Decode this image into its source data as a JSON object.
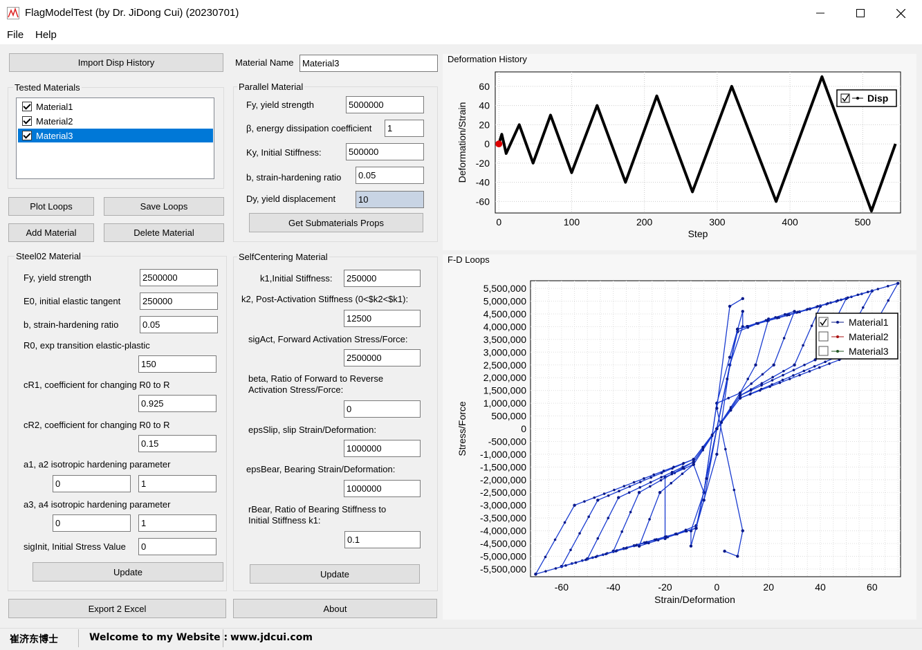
{
  "window": {
    "title": "FlagModelTest  (by Dr. JiDong Cui) (20230701)"
  },
  "menu": [
    "File",
    "Help"
  ],
  "left": {
    "import_label": "Import Disp History",
    "tested_title": "Tested Materials",
    "materials": [
      {
        "name": "Material1",
        "checked": true,
        "selected": false
      },
      {
        "name": "Material2",
        "checked": true,
        "selected": false
      },
      {
        "name": "Material3",
        "checked": true,
        "selected": true
      }
    ],
    "plot_loops": "Plot Loops",
    "save_loops": "Save Loops",
    "add_material": "Add Material",
    "delete_material": "Delete Material",
    "export_excel": "Export 2 Excel"
  },
  "material_name": {
    "label": "Material Name",
    "value": "Material3"
  },
  "parallel": {
    "title": "Parallel Material",
    "fy_label": "Fy, yield strength",
    "fy": "5000000",
    "beta_label": "β, energy dissipation coefficient",
    "beta": "1",
    "ky_label": "Ky, Initial Stiffness:",
    "ky": "500000",
    "b_label": "b, strain-hardening ratio",
    "b": "0.05",
    "dy_label": "Dy, yield displacement",
    "dy": "10",
    "get_props": "Get Submaterials Props"
  },
  "steel": {
    "title": "Steel02 Material",
    "fy_label": "Fy, yield strength",
    "fy": "2500000",
    "e0_label": "E0, initial elastic tangent",
    "e0": "250000",
    "b_label": "b, strain-hardening ratio",
    "b": "0.05",
    "r0_label": "R0, exp transition elastic-plastic",
    "r0": "150",
    "cr1_label": "cR1, coefficient for changing R0 to R",
    "cr1": "0.925",
    "cr2_label": "cR2, coefficient for changing R0 to R",
    "cr2": "0.15",
    "a12_label": "a1, a2 isotropic hardening parameter",
    "a1": "0",
    "a2": "1",
    "a34_label": "a3, a4  isotropic hardening parameter",
    "a3": "0",
    "a4": "1",
    "siginit_label": "sigInit, Initial Stress Value",
    "siginit": "0",
    "update": "Update"
  },
  "selfcentering": {
    "title": "SelfCentering Material",
    "k1_label": "k1,Initial Stiffness:",
    "k1": "250000",
    "k2_label": "k2, Post-Activation Stiffness (0<$k2<$k1):",
    "k2": "12500",
    "sigact_label": "sigAct, Forward Activation Stress/Force:",
    "sigact": "2500000",
    "beta_label1": "beta, Ratio of Forward to Reverse",
    "beta_label2": "Activation Stress/Force:",
    "beta": "0",
    "epsslip_label": "epsSlip, slip Strain/Deformation:",
    "epsslip": "1000000",
    "epsbear_label": "epsBear, Bearing Strain/Deformation:",
    "epsbear": "1000000",
    "rbear_label1": "rBear, Ratio of Bearing Stiffness to",
    "rbear_label2": "Initial Stiffness k1:",
    "rbear": "0.1",
    "update": "Update",
    "about": "About"
  },
  "chart_data": [
    {
      "type": "line",
      "panel_title": "Deformation History",
      "xlabel": "Step",
      "ylabel": "Deformation/Strain",
      "xlim": [
        -5,
        552
      ],
      "ylim": [
        -72,
        75
      ],
      "xticks": [
        0,
        100,
        200,
        300,
        400,
        500
      ],
      "yticks": [
        60,
        40,
        20,
        0,
        -20,
        -40,
        -60
      ],
      "grid": true,
      "legend": "top-right",
      "series": [
        {
          "name": "Disp",
          "color": "#000000",
          "x": [
            0,
            4,
            10,
            28,
            47,
            71,
            100,
            135,
            174,
            217,
            266,
            320,
            381,
            444,
            512,
            545
          ],
          "y": [
            0,
            10,
            -10,
            20,
            -20,
            30,
            -30,
            40,
            -40,
            50,
            -50,
            60,
            -60,
            70,
            -70,
            0
          ]
        }
      ],
      "marker": {
        "x": 0,
        "y": 0,
        "color": "#dd0000"
      }
    },
    {
      "type": "line",
      "panel_title": "F-D Loops",
      "xlabel": "Strain/Deformation",
      "ylabel": "Stress/Force",
      "xlim": [
        -72,
        71
      ],
      "ylim": [
        -5800000,
        5800000
      ],
      "xticks": [
        -60,
        -40,
        -20,
        0,
        20,
        40,
        60
      ],
      "yticks": [
        "5,500,000",
        "5,000,000",
        "4,500,000",
        "4,000,000",
        "3,500,000",
        "3,000,000",
        "2,500,000",
        "2,000,000",
        "1,500,000",
        "1,000,000",
        "500,000",
        "0",
        "-500,000",
        "-1,000,000",
        "-1,500,000",
        "-2,000,000",
        "-2,500,000",
        "-3,000,000",
        "-3,500,000",
        "-4,000,000",
        "-4,500,000",
        "-5,000,000",
        "-5,500,000"
      ],
      "grid": true,
      "legend": "top-right",
      "series": [
        {
          "name": "Material1",
          "color": "#0a1a8a",
          "checked": true
        },
        {
          "name": "Material2",
          "color": "#aa1111",
          "checked": false
        },
        {
          "name": "Material3",
          "color": "#225522",
          "checked": false
        }
      ],
      "loops": [
        {
          "amp": 10,
          "pts": [
            [
              -10,
              -4000000
            ],
            [
              -10,
              -4600000
            ],
            [
              -5,
              -2800000
            ],
            [
              0,
              -1000000
            ],
            [
              5,
              2500000
            ],
            [
              10,
              4000000
            ],
            [
              10,
              4600000
            ],
            [
              5,
              2800000
            ],
            [
              0,
              1000000
            ],
            [
              -5,
              -2500000
            ],
            [
              -10,
              -4000000
            ]
          ]
        },
        {
          "amp": 20,
          "pts": [
            [
              -20,
              -4300000
            ],
            [
              -8,
              -3800000
            ],
            [
              -5,
              -2800000
            ],
            [
              0,
              0
            ],
            [
              5,
              2500000
            ],
            [
              8,
              3800000
            ],
            [
              20,
              4300000
            ],
            [
              15,
              2500000
            ],
            [
              9,
              1400000
            ],
            [
              0,
              1000000
            ],
            [
              -5,
              -2500000
            ],
            [
              -9,
              -1400000
            ],
            [
              -20,
              -1900000
            ],
            [
              -20,
              -4300000
            ]
          ]
        },
        {
          "amp": 30,
          "pts": [
            [
              -30,
              -4600000
            ],
            [
              -8,
              -3900000
            ],
            [
              0,
              0
            ],
            [
              8,
              3900000
            ],
            [
              30,
              4600000
            ],
            [
              22,
              2500000
            ],
            [
              9,
              1400000
            ],
            [
              -9,
              -1400000
            ],
            [
              -22,
              -2500000
            ],
            [
              -30,
              -4600000
            ]
          ]
        },
        {
          "amp": 40,
          "pts": [
            [
              -40,
              -4800000
            ],
            [
              -8,
              -3900000
            ],
            [
              0,
              0
            ],
            [
              8,
              3900000
            ],
            [
              40,
              4800000
            ],
            [
              30,
              2500000
            ],
            [
              9,
              1300000
            ],
            [
              -9,
              -1300000
            ],
            [
              -30,
              -2500000
            ],
            [
              -40,
              -4800000
            ]
          ]
        },
        {
          "amp": 50,
          "pts": [
            [
              -50,
              -5100000
            ],
            [
              -8,
              -3900000
            ],
            [
              0,
              0
            ],
            [
              8,
              3900000
            ],
            [
              50,
              5100000
            ],
            [
              38,
              2700000
            ],
            [
              9,
              1300000
            ],
            [
              -9,
              -1300000
            ],
            [
              -38,
              -2700000
            ],
            [
              -50,
              -5100000
            ]
          ]
        },
        {
          "amp": 60,
          "pts": [
            [
              -60,
              -5400000
            ],
            [
              -8,
              -3900000
            ],
            [
              0,
              0
            ],
            [
              8,
              3900000
            ],
            [
              60,
              5400000
            ],
            [
              46,
              2800000
            ],
            [
              9,
              1200000
            ],
            [
              -9,
              -1200000
            ],
            [
              -46,
              -2800000
            ],
            [
              -60,
              -5400000
            ]
          ]
        },
        {
          "amp": 70,
          "pts": [
            [
              -70,
              -5700000
            ],
            [
              -8,
              -3900000
            ],
            [
              0,
              0
            ],
            [
              8,
              3900000
            ],
            [
              70,
              5700000
            ],
            [
              55,
              3000000
            ],
            [
              9,
              1200000
            ],
            [
              -9,
              -1200000
            ],
            [
              -55,
              -3000000
            ],
            [
              -70,
              -5700000
            ]
          ]
        },
        {
          "amp": 12,
          "pts": [
            [
              3,
              -4800000
            ],
            [
              8,
              -5000000
            ],
            [
              10,
              -4000000
            ],
            [
              0,
              800000
            ],
            [
              5,
              4800000
            ],
            [
              10,
              5100000
            ]
          ]
        }
      ]
    }
  ],
  "status": {
    "author": "崔济东博士",
    "welcome": "Welcome to my Website :",
    "url": "www.jdcui.com"
  }
}
